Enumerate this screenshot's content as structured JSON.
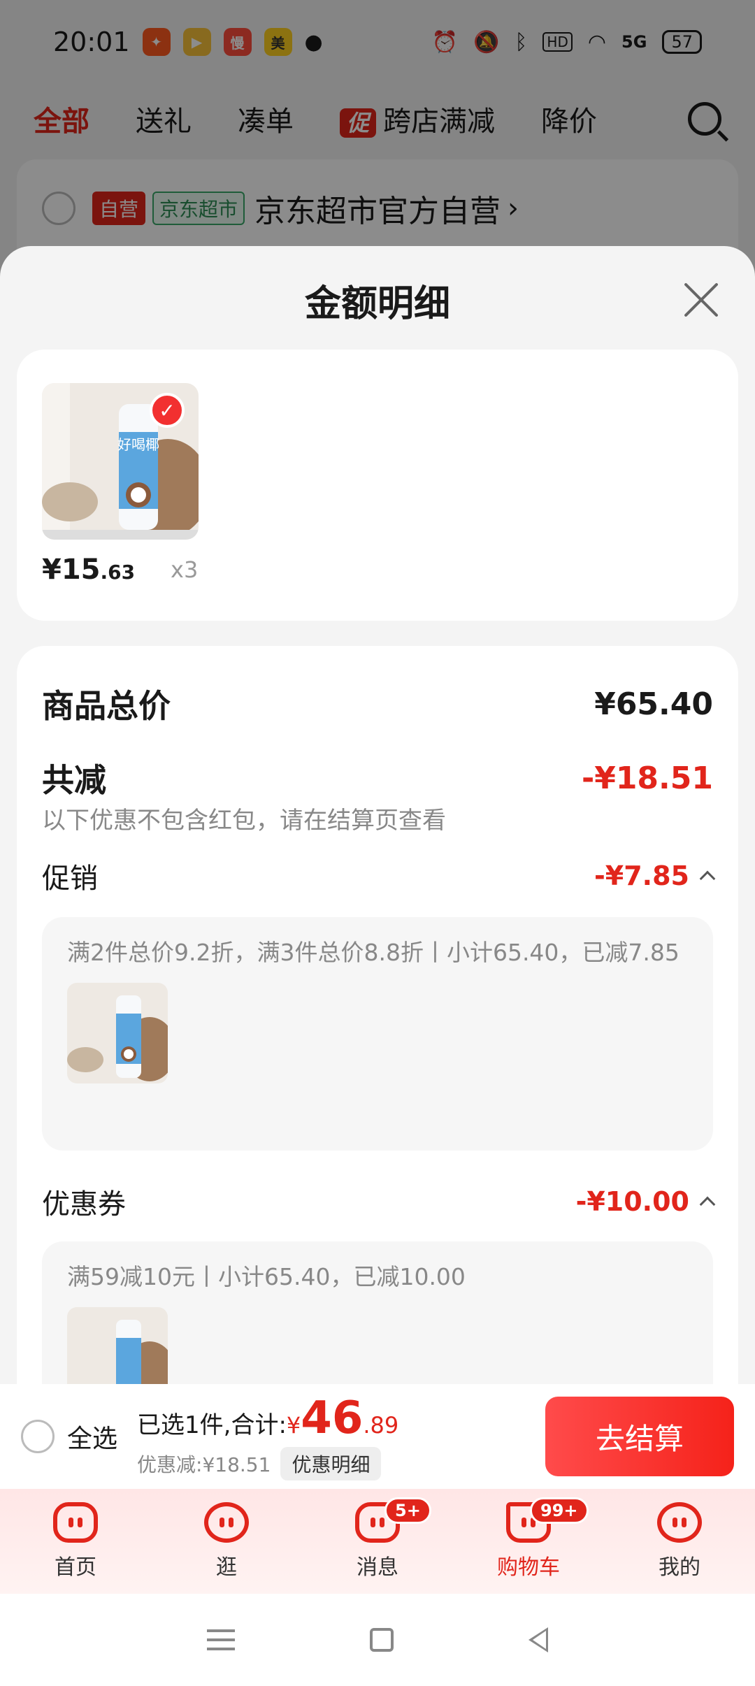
{
  "status_bar": {
    "time": "20:01",
    "battery": "57",
    "network": "5G",
    "hd": "HD"
  },
  "top_tabs": {
    "all": "全部",
    "gift": "送礼",
    "bundle": "凑单",
    "promo_tag": "促",
    "cross_store": "跨店满减",
    "price_drop": "降价"
  },
  "store": {
    "self_tag": "自营",
    "jd_tag": "京东超市",
    "name": "京东超市官方自营",
    "arrow": "›"
  },
  "sheet": {
    "title": "金额明细",
    "product": {
      "price_main": "¥15",
      "price_dec": ".63",
      "qty": "x3"
    },
    "total_label": "商品总价",
    "total_value": "¥65.40",
    "reduce_label": "共减",
    "reduce_value": "-¥18.51",
    "reduce_note": "以下优惠不包含红包，请在结算页查看",
    "promo_label": "促销",
    "promo_value": "-¥7.85",
    "promo_desc": "满2件总价9.2折，满3件总价8.8折丨小计65.40，已减7.85",
    "coupon_label": "优惠券",
    "coupon_value": "-¥10.00",
    "coupon_desc": "满59减10元丨小计65.40，已减10.00"
  },
  "checkout": {
    "select_all": "全选",
    "selected_text": "已选1件,合计:",
    "currency": "¥",
    "total_int": "46",
    "total_dec": ".89",
    "discount_text": "优惠减:¥18.51",
    "detail_chip": "优惠明细",
    "button": "去结算"
  },
  "tabbar": {
    "home": "首页",
    "browse": "逛",
    "messages": "消息",
    "messages_badge": "5+",
    "cart": "购物车",
    "cart_badge": "99+",
    "mine": "我的"
  },
  "colors": {
    "accent": "#e1251b",
    "jd_green": "#2d8c54"
  },
  "product_label": "好喝椰"
}
